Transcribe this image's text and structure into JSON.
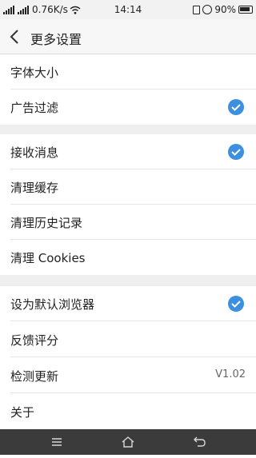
{
  "status_bar": {
    "network_speed": "0.76K/s",
    "time": "14:14",
    "battery": "90%"
  },
  "header": {
    "title": "更多设置"
  },
  "settings": {
    "font_size": "字体大小",
    "ad_filter": "广告过滤",
    "receive_messages": "接收消息",
    "clear_cache": "清理缓存",
    "clear_history": "清理历史记录",
    "clear_cookies": "清理 Cookies",
    "default_browser": "设为默认浏览器",
    "feedback": "反馈评分",
    "check_update": "检测更新",
    "current_version": "V1.02",
    "about": "关于"
  },
  "checked": {
    "ad_filter": true,
    "receive_messages": true,
    "default_browser": true
  },
  "colors": {
    "accent": "#3d8fe0",
    "section_gap": "#efefef",
    "nav_bar": "#3b3b3b"
  }
}
